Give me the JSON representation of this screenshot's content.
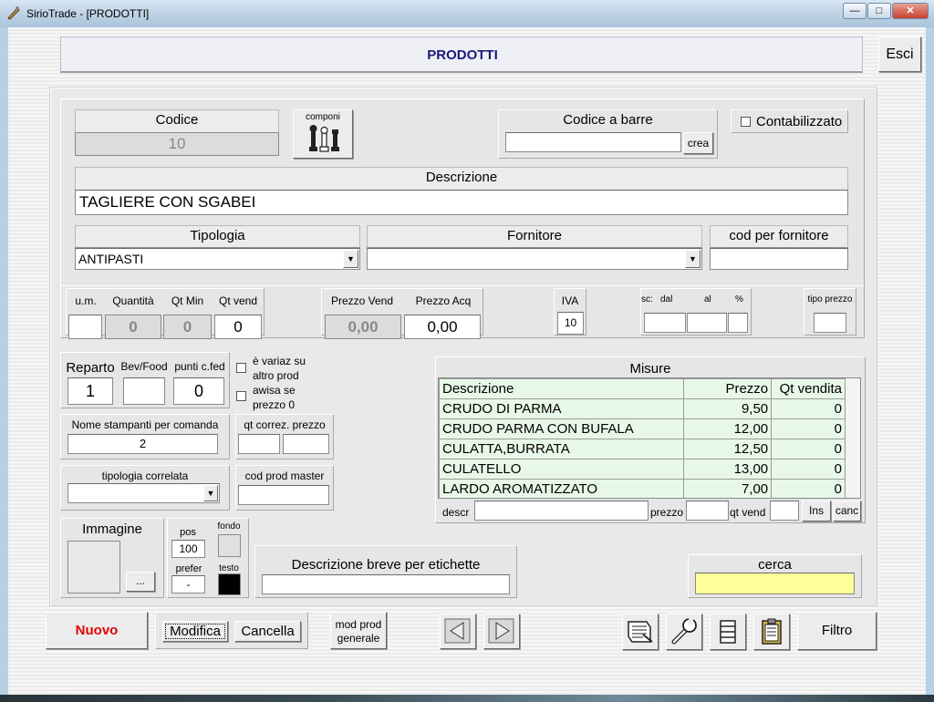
{
  "window": {
    "title": "SirioTrade - [PRODOTTI]"
  },
  "header": {
    "title": "PRODOTTI",
    "exit_label": "Esci"
  },
  "codice": {
    "label": "Codice",
    "value": "10",
    "componi_label": "componi"
  },
  "barcode": {
    "label": "Codice a barre",
    "value": "",
    "crea_label": "crea"
  },
  "contabilizzato": {
    "label": "Contabilizzato",
    "checked": false
  },
  "descrizione": {
    "label": "Descrizione",
    "value": "TAGLIERE CON SGABEI"
  },
  "tipologia": {
    "label": "Tipologia",
    "value": "ANTIPASTI"
  },
  "fornitore": {
    "label": "Fornitore",
    "value": ""
  },
  "cod_fornitore": {
    "label": "cod per fornitore",
    "value": ""
  },
  "qty": {
    "um_label": "u.m.",
    "um_value": "",
    "quantita_label": "Quantità",
    "quantita_value": "0",
    "qtmin_label": "Qt Min",
    "qtmin_value": "0",
    "qtvend_label": "Qt vend",
    "qtvend_value": "0"
  },
  "prezzi": {
    "vend_label": "Prezzo Vend",
    "vend_value": "0,00",
    "acq_label": "Prezzo Acq",
    "acq_value": "0,00"
  },
  "iva": {
    "label": "IVA",
    "value": "10"
  },
  "sconto": {
    "sc_label": "sc:",
    "dal_label": "dal",
    "al_label": "al",
    "pct_label": "%"
  },
  "tipo_prezzo": {
    "label": "tipo prezzo",
    "value": ""
  },
  "reparto": {
    "reparto_label": "Reparto",
    "reparto_value": "1",
    "bevfood_label": "Bev/Food",
    "bevfood_value": "",
    "punti_label": "punti c.fed",
    "punti_value": "0"
  },
  "variaz": {
    "label_1": "è variaz su",
    "label_2": "altro prod"
  },
  "awisa": {
    "label_1": "awisa se",
    "label_2": "prezzo 0"
  },
  "stampanti": {
    "label": "Nome stampanti per comanda",
    "value": "2"
  },
  "qtcorrez": {
    "label": "qt correz. prezzo"
  },
  "tipologia_correlata": {
    "label": "tipologia correlata",
    "value": ""
  },
  "cod_master": {
    "label": "cod prod master",
    "value": ""
  },
  "immagine": {
    "label": "Immagine",
    "browse_label": "..."
  },
  "pos": {
    "label": "pos",
    "value": "100",
    "prefer_label": "prefer",
    "prefer_value": "-"
  },
  "colori": {
    "fondo_label": "fondo",
    "testo_label": "testo"
  },
  "desc_breve": {
    "label": "Descrizione breve per etichette",
    "value": ""
  },
  "misure": {
    "title": "Misure",
    "columns": [
      "Descrizione",
      "Prezzo",
      "Qt vendita"
    ],
    "rows": [
      [
        "CRUDO DI PARMA",
        "9,50",
        "0"
      ],
      [
        "CRUDO PARMA CON BUFALA",
        "12,00",
        "0"
      ],
      [
        "CULATTA,BURRATA",
        "12,50",
        "0"
      ],
      [
        "CULATELLO",
        "13,00",
        "0"
      ],
      [
        "LARDO AROMATIZZATO",
        "7,00",
        "0"
      ]
    ],
    "descr_label": "descr",
    "prezzo_label": "prezzo",
    "qtvend_label": "qt vend",
    "ins_label": "Ins",
    "canc_label": "canc"
  },
  "cerca": {
    "label": "cerca",
    "value": ""
  },
  "bottom": {
    "nuovo_label": "Nuovo",
    "modifica_label": "Modifica",
    "cancella_label": "Cancella",
    "modprod_label_1": "mod prod",
    "modprod_label_2": "generale",
    "filtro_label": "Filtro"
  },
  "colors": {
    "nuovo_text": "#e00000",
    "title_text": "#1a1a7a",
    "cerca_bg": "#ffff99",
    "grid_bg": "#e8f8e8"
  }
}
